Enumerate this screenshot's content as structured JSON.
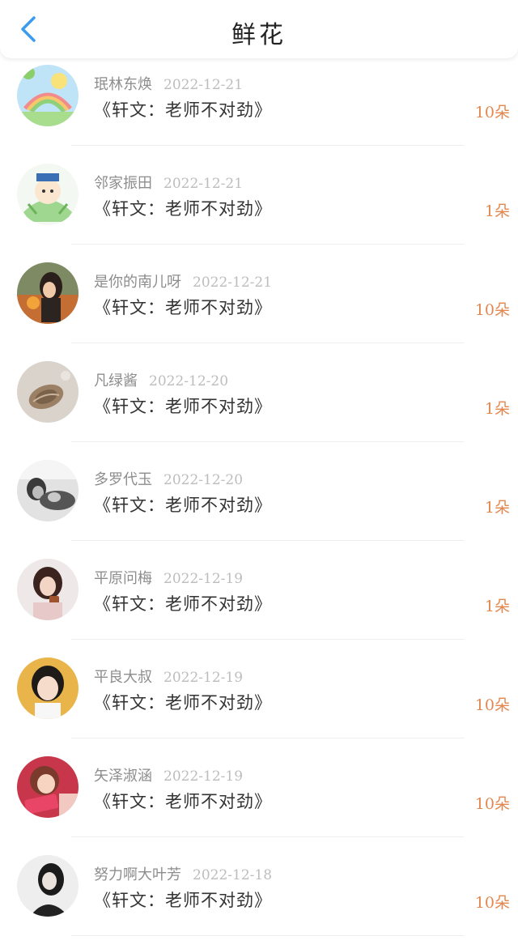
{
  "header": {
    "title": "鲜花",
    "back_icon": "chevron-left-icon",
    "accent": "#3a9bf0"
  },
  "colors": {
    "count": "#e2874f",
    "name": "#8d8d8d",
    "date": "#bdbdbd"
  },
  "items": [
    {
      "name": "珉林东焕",
      "date": "2022-12-21",
      "book": "《轩文：老师不对劲》",
      "count": "10朵",
      "avatar": "cartoon-rainbow-avatar"
    },
    {
      "name": "邻家振田",
      "date": "2022-12-21",
      "book": "《轩文：老师不对劲》",
      "count": "1朵",
      "avatar": "cartoon-character-avatar"
    },
    {
      "name": "是你的南儿呀",
      "date": "2022-12-21",
      "book": "《轩文：老师不对劲》",
      "count": "10朵",
      "avatar": "girl-photo-avatar"
    },
    {
      "name": "凡绿酱",
      "date": "2022-12-20",
      "book": "《轩文：老师不对劲》",
      "count": "1朵",
      "avatar": "shell-photo-avatar"
    },
    {
      "name": "多罗代玉",
      "date": "2022-12-20",
      "book": "《轩文：老师不对劲》",
      "count": "1朵",
      "avatar": "bw-photo-avatar"
    },
    {
      "name": "平原问梅",
      "date": "2022-12-19",
      "book": "《轩文：老师不对劲》",
      "count": "1朵",
      "avatar": "girl-cup-avatar"
    },
    {
      "name": "平良大叔",
      "date": "2022-12-19",
      "book": "《轩文：老师不对劲》",
      "count": "10朵",
      "avatar": "girl-portrait-avatar"
    },
    {
      "name": "矢泽淑涵",
      "date": "2022-12-19",
      "book": "《轩文：老师不对劲》",
      "count": "10朵",
      "avatar": "girl-red-avatar"
    },
    {
      "name": "努力啊大叶芳",
      "date": "2022-12-18",
      "book": "《轩文：老师不对劲》",
      "count": "10朵",
      "avatar": "woman-bw-avatar"
    }
  ]
}
